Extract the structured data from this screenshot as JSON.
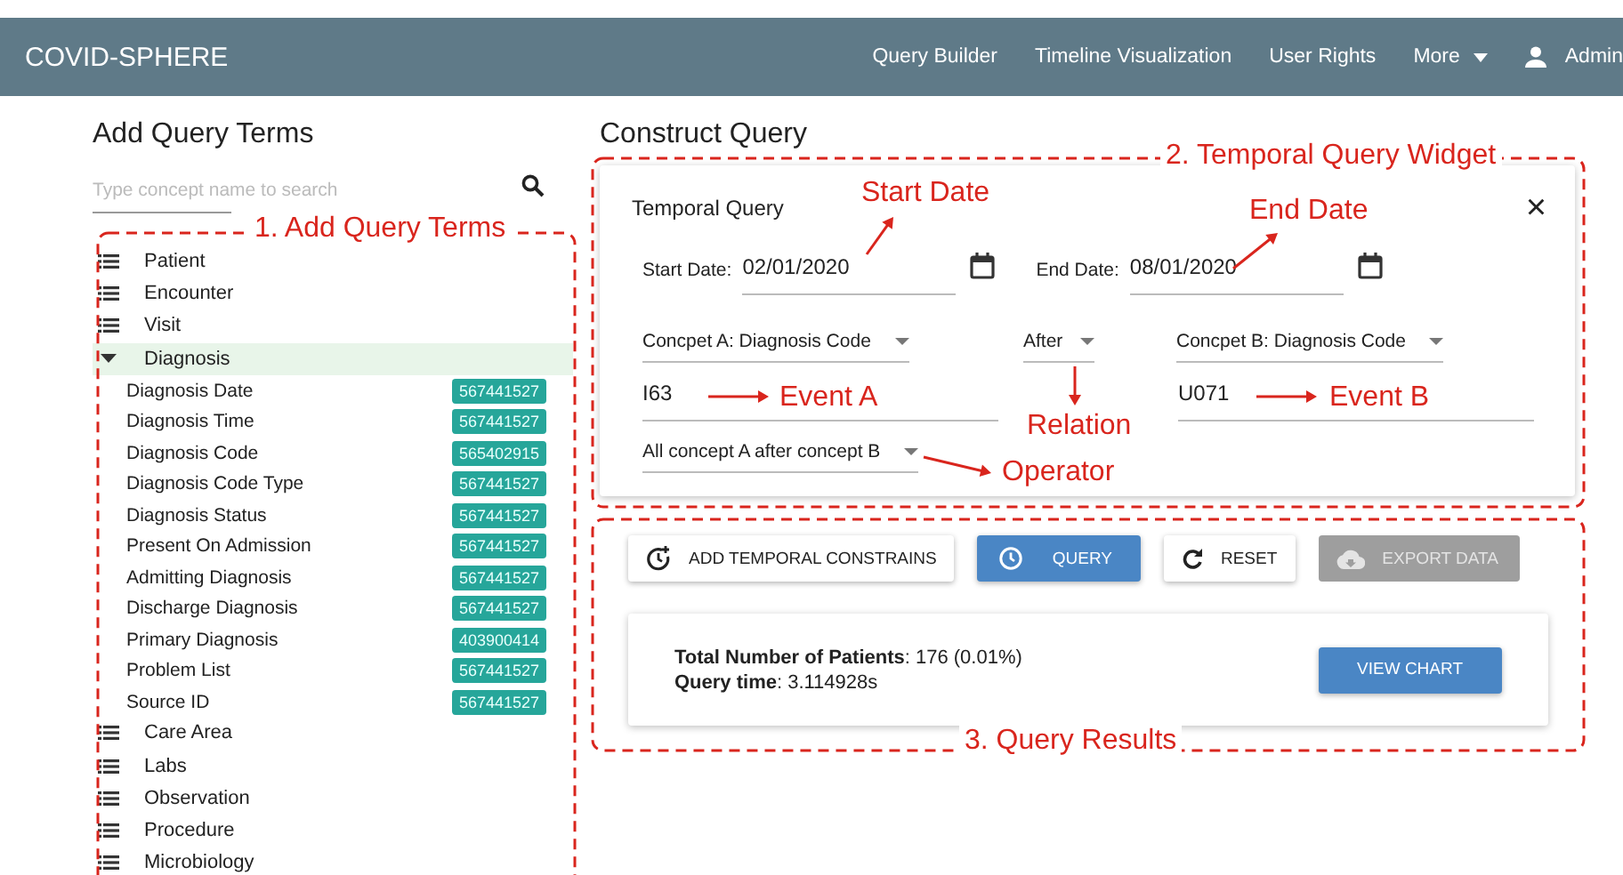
{
  "header": {
    "brand": "COVID-SPHERE",
    "nav": [
      {
        "label": "Query Builder",
        "kind": "link"
      },
      {
        "label": "Timeline Visualization",
        "kind": "link"
      },
      {
        "label": "User Rights",
        "kind": "link"
      },
      {
        "label": "More",
        "kind": "menu"
      },
      {
        "label": "Admin",
        "kind": "user"
      }
    ]
  },
  "left": {
    "title": "Add Query Terms",
    "search": {
      "placeholder": "Type concept name to search"
    },
    "tree": [
      {
        "label": "Patient",
        "expanded": false
      },
      {
        "label": "Encounter",
        "expanded": false
      },
      {
        "label": "Visit",
        "expanded": false
      },
      {
        "label": "Diagnosis",
        "expanded": true,
        "selected": true,
        "children": [
          {
            "label": "Diagnosis Date",
            "count": "567441527"
          },
          {
            "label": "Diagnosis Time",
            "count": "567441527"
          },
          {
            "label": "Diagnosis Code",
            "count": "565402915"
          },
          {
            "label": "Diagnosis Code Type",
            "count": "567441527"
          },
          {
            "label": "Diagnosis Status",
            "count": "567441527"
          },
          {
            "label": "Present On Admission",
            "count": "567441527"
          },
          {
            "label": "Admitting Diagnosis",
            "count": "567441527"
          },
          {
            "label": "Discharge Diagnosis",
            "count": "567441527"
          },
          {
            "label": "Primary Diagnosis",
            "count": "403900414"
          },
          {
            "label": "Problem List",
            "count": "567441527"
          },
          {
            "label": "Source ID",
            "count": "567441527"
          }
        ]
      },
      {
        "label": "Care Area",
        "expanded": false
      },
      {
        "label": "Labs",
        "expanded": false
      },
      {
        "label": "Observation",
        "expanded": false
      },
      {
        "label": "Procedure",
        "expanded": false
      },
      {
        "label": "Microbiology",
        "expanded": false
      }
    ]
  },
  "right": {
    "title": "Construct Query",
    "widget": {
      "title": "Temporal Query",
      "close": "×",
      "start_label": "Start Date:",
      "start_value": "02/01/2020",
      "end_label": "End Date:",
      "end_value": "08/01/2020",
      "concept_a": "Concpet A: Diagnosis Code",
      "relation": "After",
      "concept_b": "Concpet B: Diagnosis Code",
      "event_a": "I63",
      "event_b": "U071",
      "operator": "All concept A after concept B"
    },
    "buttons": [
      {
        "label": "ADD TEMPORAL CONSTRAINS",
        "kind": "plain",
        "disabled": false
      },
      {
        "label": "QUERY",
        "kind": "primary",
        "disabled": false
      },
      {
        "label": "RESET",
        "kind": "plain",
        "disabled": false
      },
      {
        "label": "EXPORT DATA",
        "kind": "plain",
        "disabled": true
      }
    ],
    "result": {
      "lines": [
        "**Total Number of Patients**: 176 (0.01%)",
        "**Query time**: 3.114928s"
      ],
      "button": "VIEW CHART"
    }
  },
  "annotations": [
    {
      "text": "1. Add Query Terms",
      "kind": "frame"
    },
    {
      "text": "2. Temporal Query Widget",
      "kind": "frame"
    },
    {
      "text": "3. Query Results",
      "kind": "frame"
    },
    {
      "text": "Start Date",
      "kind": "callout"
    },
    {
      "text": "End Date",
      "kind": "callout"
    },
    {
      "text": "Event A",
      "kind": "callout"
    },
    {
      "text": "Event B",
      "kind": "callout"
    },
    {
      "text": "Relation",
      "kind": "callout"
    },
    {
      "text": "Operator",
      "kind": "callout"
    }
  ]
}
